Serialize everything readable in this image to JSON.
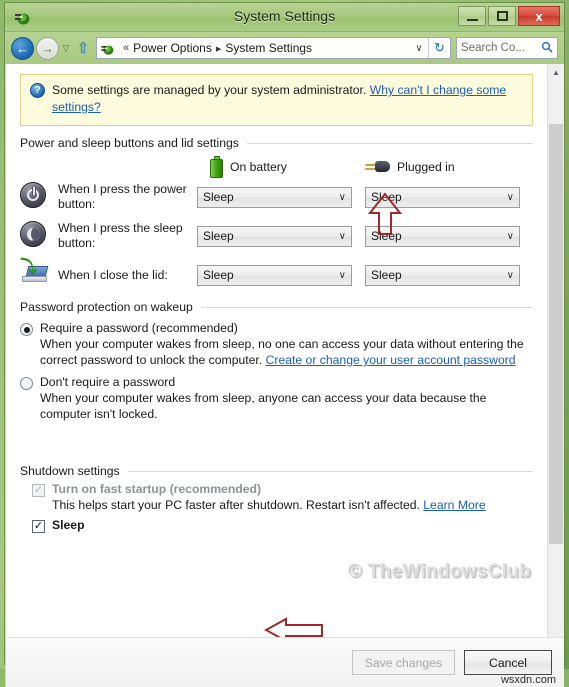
{
  "window": {
    "title": "System Settings",
    "app_icon": "power-options-icon",
    "minimize_label": "Minimize",
    "maximize_label": "Maximize",
    "close_label": "x"
  },
  "navbar": {
    "back_glyph": "←",
    "forward_glyph": "→",
    "history_glyph": "▽",
    "up_glyph": "⇧",
    "breadcrumb": {
      "prefix": "«",
      "items": [
        "Power Options",
        "System Settings"
      ],
      "separator": "▸"
    },
    "address_dropdown_glyph": "∨",
    "refresh_glyph": "↻",
    "search_placeholder": "Search Co...",
    "search_value": "",
    "search_icon_glyph": "⌕"
  },
  "banner": {
    "icon": "help-circle-icon",
    "icon_glyph": "?",
    "text": "Some settings are managed by your system administrator.",
    "link": "Why can't I change some settings?"
  },
  "sections": {
    "power_sleep": {
      "heading": "Power and sleep buttons and lid settings",
      "columns": [
        {
          "label": "On battery",
          "icon": "battery-icon"
        },
        {
          "label": "Plugged in",
          "icon": "power-plug-icon"
        }
      ],
      "rows": [
        {
          "icon": "power-button-icon",
          "label": "When I press the power button:",
          "on_battery": "Sleep",
          "plugged_in": "Sleep"
        },
        {
          "icon": "sleep-button-icon",
          "label": "When I press the sleep button:",
          "on_battery": "Sleep",
          "plugged_in": "Sleep"
        },
        {
          "icon": "laptop-lid-icon",
          "label": "When I close the lid:",
          "on_battery": "Sleep",
          "plugged_in": "Sleep"
        }
      ],
      "dropdown_chevron": "∨"
    },
    "password_protection": {
      "heading": "Password protection on wakeup",
      "options": [
        {
          "label": "Require a password (recommended)",
          "selected": true,
          "description_before": "When your computer wakes from sleep, no one can access your data without entering the correct password to unlock the computer. ",
          "link": "Create or change your user account password",
          "description_after": ""
        },
        {
          "label": "Don't require a password",
          "selected": false,
          "description_before": "When your computer wakes from sleep, anyone can access your data because the computer isn't locked.",
          "link": "",
          "description_after": ""
        }
      ]
    },
    "shutdown": {
      "heading": "Shutdown settings",
      "items": [
        {
          "label": "Turn on fast startup (recommended)",
          "checked": true,
          "disabled": true,
          "check_glyph": "✓",
          "description_before": "This helps start your PC faster after shutdown. Restart isn't affected. ",
          "link": "Learn More"
        },
        {
          "label": "Sleep",
          "checked": true,
          "disabled": false,
          "check_glyph": "✓",
          "description_before": "",
          "link": ""
        }
      ]
    }
  },
  "watermark": {
    "text": "© TheWindowsClub",
    "footer_text": "wsxdn.com"
  },
  "annotations": [
    {
      "name": "arrow-up-annotation",
      "color": "#9e2b2b",
      "direction": "up"
    },
    {
      "name": "arrow-left-annotation",
      "color": "#9e2b2b",
      "direction": "left"
    }
  ],
  "footer": {
    "save_label": "Save changes",
    "save_enabled": false,
    "cancel_label": "Cancel",
    "cancel_enabled": true
  },
  "scrollbar": {
    "up_glyph": "▲",
    "down_glyph": "▼"
  }
}
